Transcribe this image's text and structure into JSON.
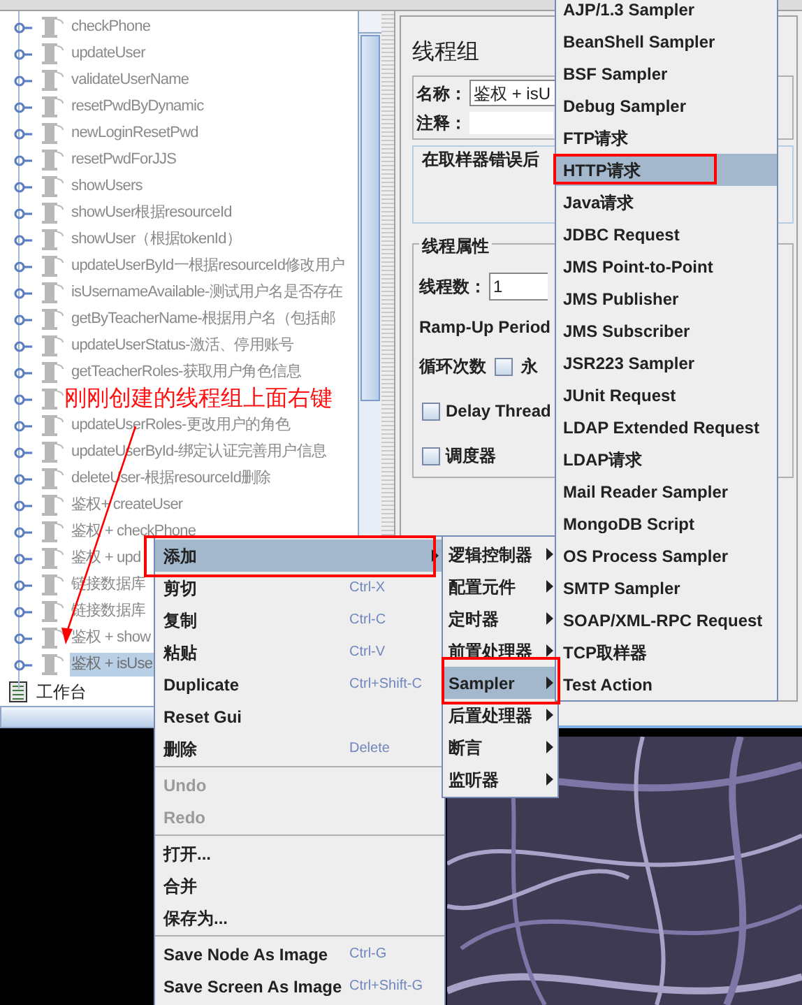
{
  "tree": {
    "items": [
      {
        "label": "checkPhone",
        "selected": false
      },
      {
        "label": "updateUser",
        "selected": false
      },
      {
        "label": "validateUserName",
        "selected": false
      },
      {
        "label": "resetPwdByDynamic",
        "selected": false
      },
      {
        "label": "newLoginResetPwd",
        "selected": false
      },
      {
        "label": "resetPwdForJJS",
        "selected": false
      },
      {
        "label": "showUsers",
        "selected": false
      },
      {
        "label": "showUser根据resourceId",
        "selected": false
      },
      {
        "label": "showUser（根据tokenId）",
        "selected": false
      },
      {
        "label": "updateUserById一根据resourceId修改用户",
        "selected": false
      },
      {
        "label": "isUsernameAvailable-测试用户名是否存在",
        "selected": false
      },
      {
        "label": "getByTeacherName-根据用户名（包括邮",
        "selected": false
      },
      {
        "label": "updateUserStatus-激活、停用账号",
        "selected": false
      },
      {
        "label": "getTeacherRoles-获取用户角色信息",
        "selected": false
      },
      {
        "kind": "covered"
      },
      {
        "label": "updateUserRoles-更改用户的角色",
        "selected": false
      },
      {
        "label": "updateUserById-绑定认证完善用户信息",
        "selected": false
      },
      {
        "label": "deleteUser-根据resourceId删除",
        "selected": false
      },
      {
        "label": "鉴权+ createUser",
        "selected": false
      },
      {
        "label": "鉴权 + checkPhone",
        "selected": false
      },
      {
        "label": "鉴权 +   upd",
        "selected": false
      },
      {
        "label": "链接数据库",
        "selected": false
      },
      {
        "label": "链接数据库",
        "selected": false
      },
      {
        "label": "鉴权 + show",
        "selected": false
      },
      {
        "label": "鉴权 + isUse",
        "selected": true
      }
    ],
    "root": {
      "label": "工作台"
    }
  },
  "annotation": {
    "text": "刚刚创建的线程组上面右键"
  },
  "panel": {
    "title": "线程组",
    "name_label": "名称：",
    "name_value": "鉴权 + isU",
    "comment_label": "注释：",
    "error_group": "在取样器错误后",
    "thread_group": "线程属性",
    "threads_label": "线程数：",
    "threads_value": "1",
    "rampup_label": "Ramp-Up Period",
    "loop_label": "循环次数",
    "forever": {
      "label": "永",
      "checked": false
    },
    "delay": {
      "label": "Delay Thread",
      "checked": false
    },
    "scheduler": {
      "label": "调度器",
      "checked": false
    }
  },
  "context_menu": {
    "items": [
      {
        "kind": "item",
        "label": "添加",
        "selected": true,
        "disabled": false,
        "submenu": true
      },
      {
        "kind": "item",
        "label": "剪切",
        "shortcut": "Ctrl-X",
        "selected": false,
        "disabled": false
      },
      {
        "kind": "item",
        "label": "复制",
        "shortcut": "Ctrl-C",
        "selected": false,
        "disabled": false
      },
      {
        "kind": "item",
        "label": "粘贴",
        "shortcut": "Ctrl-V",
        "selected": false,
        "disabled": false
      },
      {
        "kind": "item",
        "label": "Duplicate",
        "shortcut": "Ctrl+Shift-C",
        "selected": false,
        "disabled": false
      },
      {
        "kind": "item",
        "label": "Reset Gui",
        "selected": false,
        "disabled": false
      },
      {
        "kind": "item",
        "label": "删除",
        "shortcut": "Delete",
        "selected": false,
        "disabled": false
      },
      {
        "kind": "separator"
      },
      {
        "kind": "item",
        "label": "Undo",
        "selected": false,
        "disabled": true
      },
      {
        "kind": "item",
        "label": "Redo",
        "selected": false,
        "disabled": true
      },
      {
        "kind": "separator"
      },
      {
        "kind": "item",
        "label": "打开...",
        "selected": false,
        "disabled": false
      },
      {
        "kind": "item",
        "label": "合并",
        "selected": false,
        "disabled": false
      },
      {
        "kind": "item",
        "label": "保存为...",
        "selected": false,
        "disabled": false
      },
      {
        "kind": "separator"
      },
      {
        "kind": "item",
        "label": "Save Node As Image",
        "shortcut": "Ctrl-G",
        "selected": false,
        "disabled": false
      },
      {
        "kind": "item",
        "label": "Save Screen As Image",
        "shortcut": "Ctrl+Shift-G",
        "selected": false,
        "disabled": false
      }
    ]
  },
  "add_menu": {
    "items": [
      {
        "label": "逻辑控制器",
        "selected": false
      },
      {
        "label": "配置元件",
        "selected": false
      },
      {
        "label": "定时器",
        "selected": false
      },
      {
        "label": "前置处理器",
        "selected": false
      },
      {
        "label": "Sampler",
        "selected": true
      },
      {
        "label": "后置处理器",
        "selected": false
      },
      {
        "label": "断言",
        "selected": false
      },
      {
        "label": "监听器",
        "selected": false
      }
    ]
  },
  "sampler_menu": {
    "items": [
      {
        "label": "AJP/1.3 Sampler",
        "selected": false
      },
      {
        "label": "BeanShell Sampler",
        "selected": false
      },
      {
        "label": "BSF Sampler",
        "selected": false
      },
      {
        "label": "Debug Sampler",
        "selected": false
      },
      {
        "label": "FTP请求",
        "selected": false
      },
      {
        "label": "HTTP请求",
        "selected": true
      },
      {
        "label": "Java请求",
        "selected": false
      },
      {
        "label": "JDBC Request",
        "selected": false
      },
      {
        "label": "JMS Point-to-Point",
        "selected": false
      },
      {
        "label": "JMS Publisher",
        "selected": false
      },
      {
        "label": "JMS Subscriber",
        "selected": false
      },
      {
        "label": "JSR223 Sampler",
        "selected": false
      },
      {
        "label": "JUnit Request",
        "selected": false
      },
      {
        "label": "LDAP Extended Request",
        "selected": false
      },
      {
        "label": "LDAP请求",
        "selected": false
      },
      {
        "label": "Mail Reader Sampler",
        "selected": false
      },
      {
        "label": "MongoDB Script",
        "selected": false
      },
      {
        "label": "OS Process Sampler",
        "selected": false
      },
      {
        "label": "SMTP Sampler",
        "selected": false
      },
      {
        "label": "SOAP/XML-RPC Request",
        "selected": false
      },
      {
        "label": "TCP取样器",
        "selected": false
      },
      {
        "label": "Test Action",
        "selected": false
      }
    ]
  }
}
